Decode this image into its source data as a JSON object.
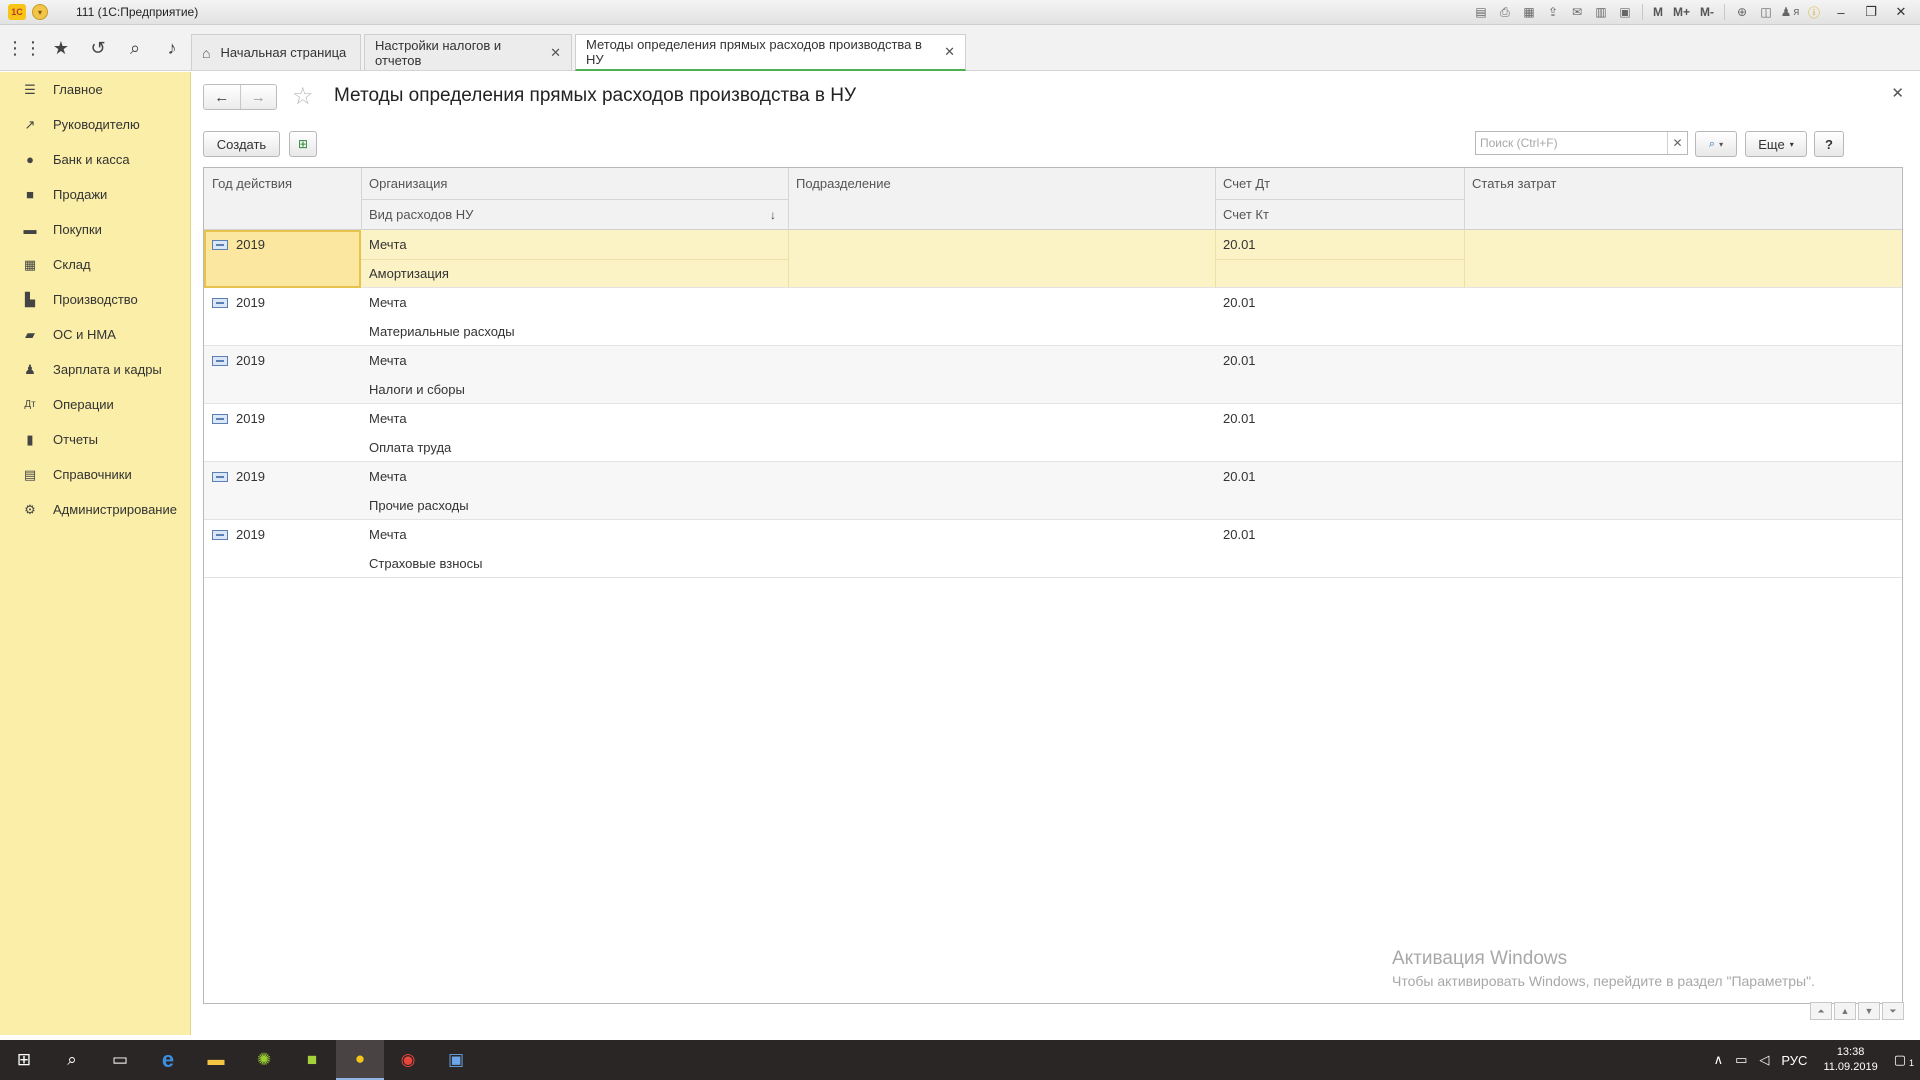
{
  "window": {
    "title": "111 (1С:Предприятие)",
    "logo": "1С",
    "toolbar_letters": [
      "M",
      "M+",
      "M-"
    ],
    "user": "я"
  },
  "top_icons": [
    "apps-grid-icon",
    "star-icon",
    "history-icon",
    "search-icon",
    "bell-icon"
  ],
  "tabs": [
    {
      "label": "Начальная страница",
      "closable": false
    },
    {
      "label": "Настройки налогов и отчетов",
      "closable": true
    },
    {
      "label": "Методы определения прямых расходов производства в НУ",
      "closable": true,
      "active": true
    }
  ],
  "sidebar": {
    "items": [
      {
        "label": "Главное",
        "icon": "menu-icon"
      },
      {
        "label": "Руководителю",
        "icon": "chart-trend-icon"
      },
      {
        "label": "Банк и касса",
        "icon": "coin-icon"
      },
      {
        "label": "Продажи",
        "icon": "bag-icon"
      },
      {
        "label": "Покупки",
        "icon": "cart-icon"
      },
      {
        "label": "Склад",
        "icon": "warehouse-icon"
      },
      {
        "label": "Производство",
        "icon": "factory-icon"
      },
      {
        "label": "ОС и НМА",
        "icon": "truck-icon"
      },
      {
        "label": "Зарплата и кадры",
        "icon": "person-icon"
      },
      {
        "label": "Операции",
        "icon": "operations-icon"
      },
      {
        "label": "Отчеты",
        "icon": "bar-chart-icon"
      },
      {
        "label": "Справочники",
        "icon": "book-icon"
      },
      {
        "label": "Администрирование",
        "icon": "gear-icon"
      }
    ]
  },
  "form": {
    "title": "Методы определения прямых расходов производства в НУ",
    "create_label": "Создать",
    "search_placeholder": "Поиск (Ctrl+F)",
    "more_label": "Еще",
    "help_label": "?"
  },
  "table": {
    "headers": {
      "year": "Год действия",
      "org": "Организация",
      "expense_type": "Вид расходов НУ",
      "division": "Подразделение",
      "debit": "Счет Дт",
      "credit": "Счет Кт",
      "cost_item": "Статья затрат"
    },
    "rows": [
      {
        "year": "2019",
        "org": "Мечта",
        "expense_type": "Амортизация",
        "debit": "20.01",
        "selected": true
      },
      {
        "year": "2019",
        "org": "Мечта",
        "expense_type": "Материальные расходы",
        "debit": "20.01"
      },
      {
        "year": "2019",
        "org": "Мечта",
        "expense_type": "Налоги и сборы",
        "debit": "20.01"
      },
      {
        "year": "2019",
        "org": "Мечта",
        "expense_type": "Оплата труда",
        "debit": "20.01"
      },
      {
        "year": "2019",
        "org": "Мечта",
        "expense_type": "Прочие расходы",
        "debit": "20.01"
      },
      {
        "year": "2019",
        "org": "Мечта",
        "expense_type": "Страховые взносы",
        "debit": "20.01"
      }
    ]
  },
  "watermark": {
    "line1": "Активация Windows",
    "line2": "Чтобы активировать Windows, перейдите в раздел \"Параметры\"."
  },
  "taskbar": {
    "lang": "РУС",
    "time": "13:38",
    "date": "11.09.2019",
    "notifications": "1"
  },
  "colors": {
    "sidebar": "#faeea8",
    "selection": "#fbe7a0",
    "active_tab_accent": "#4caf50"
  }
}
